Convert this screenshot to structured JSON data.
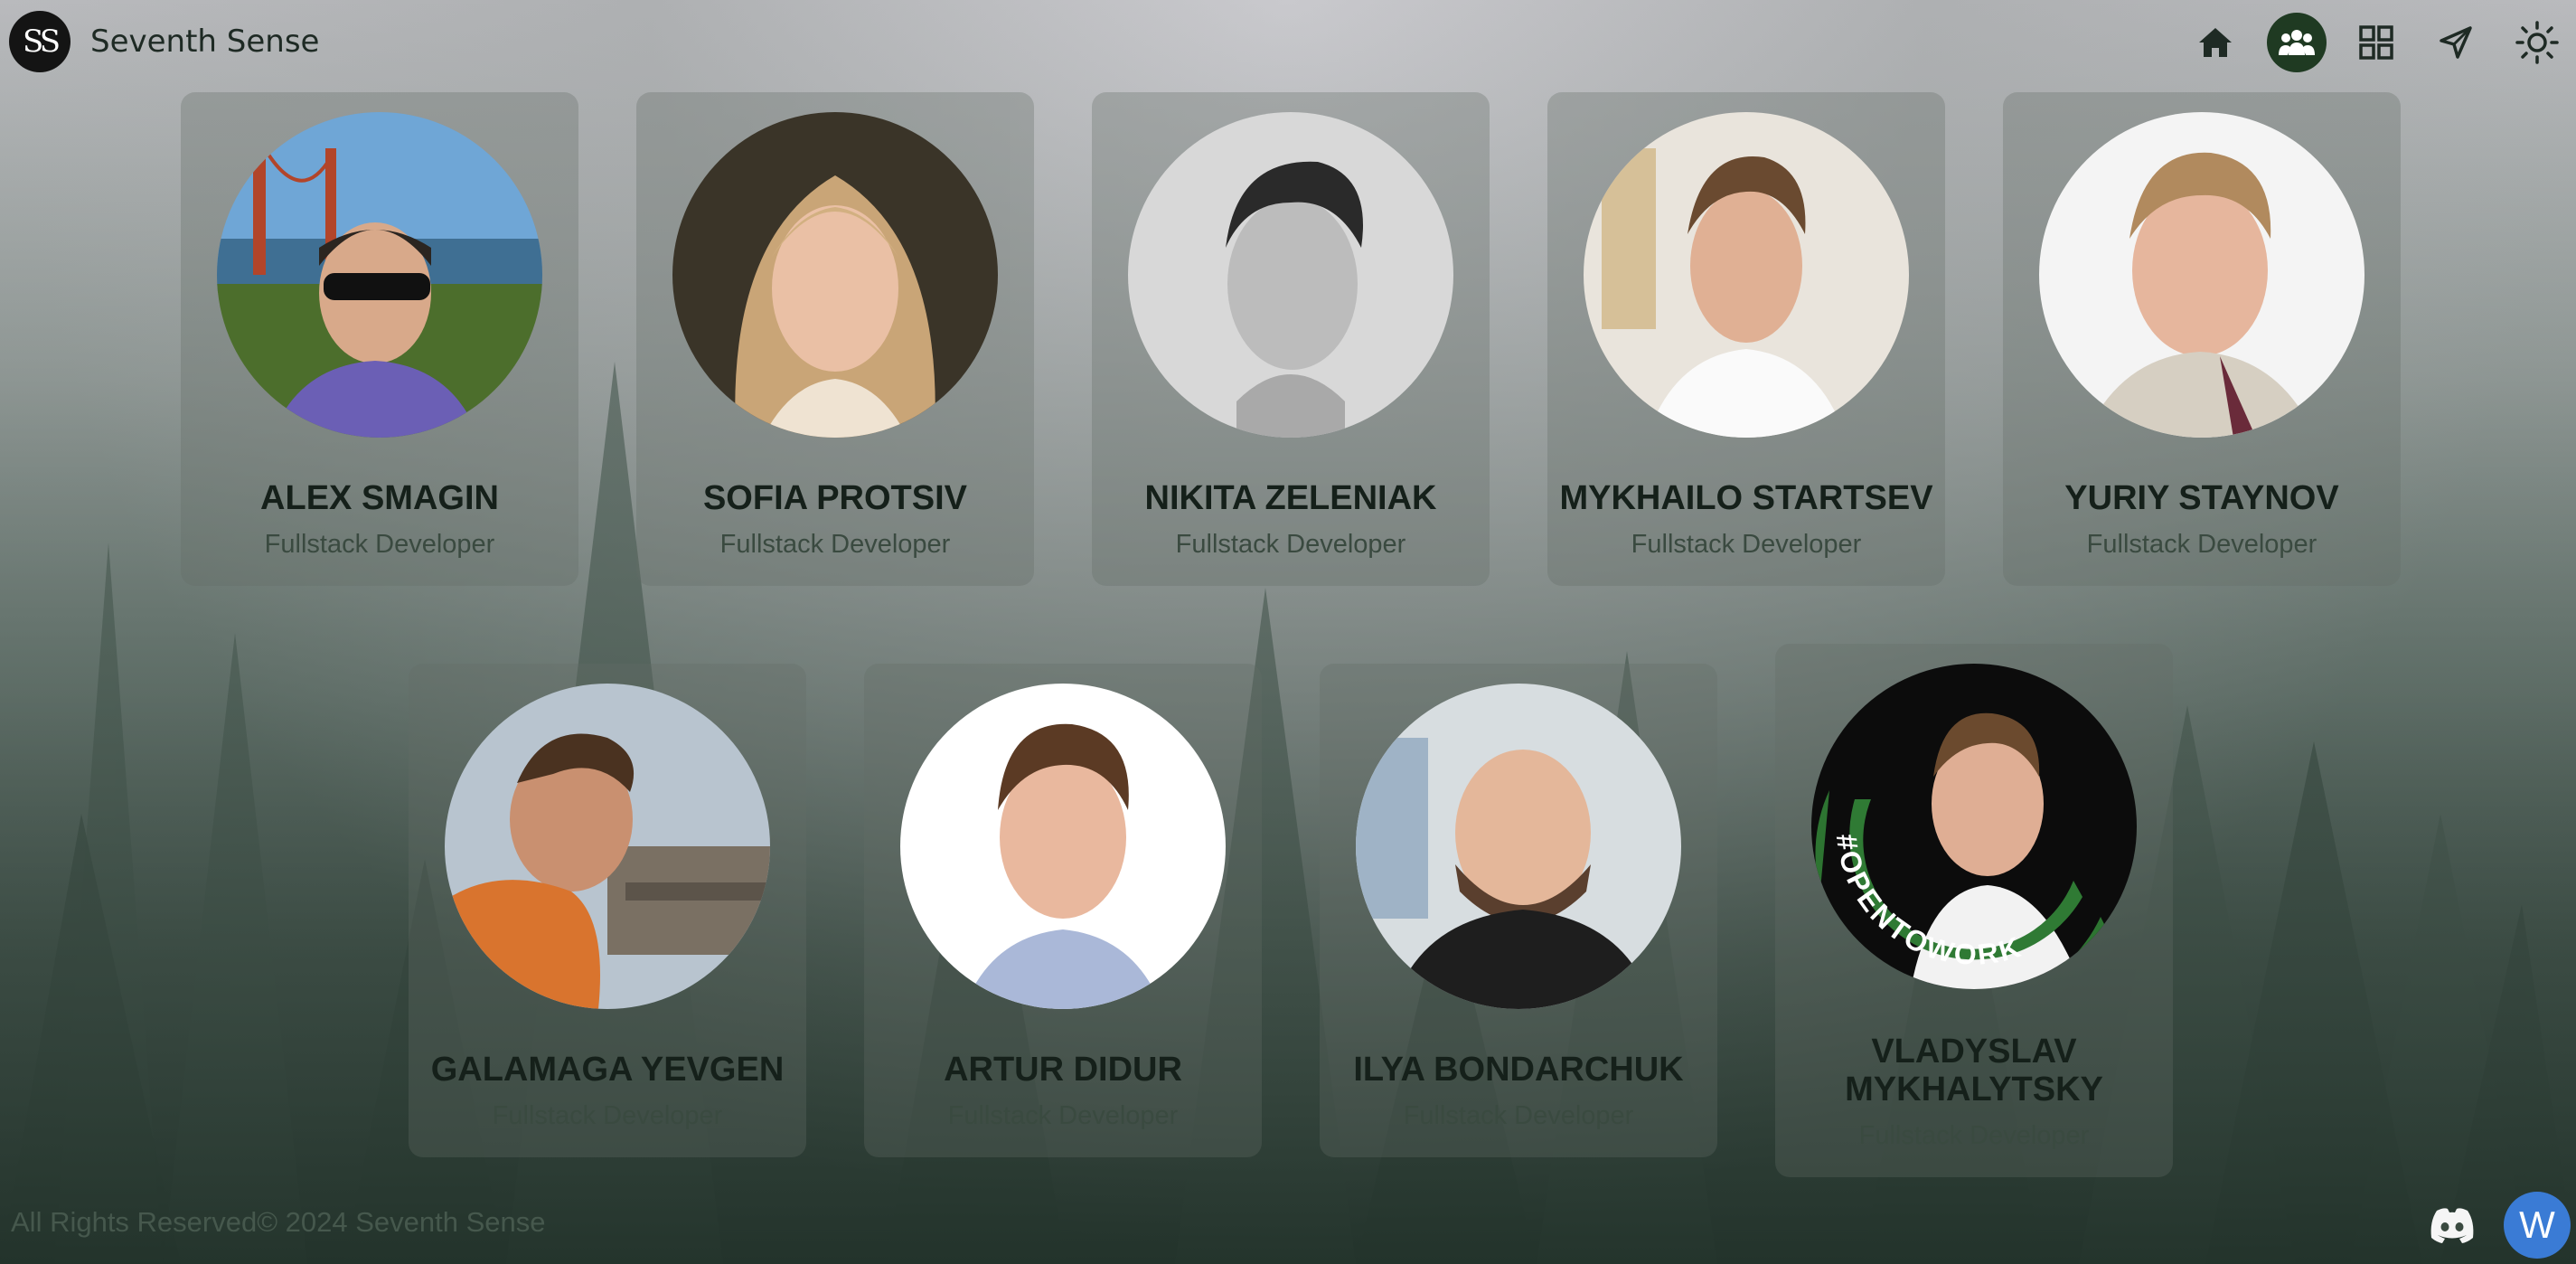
{
  "header": {
    "logo_text": "SS",
    "brand": "Seventh Sense",
    "nav": [
      {
        "icon": "home-icon"
      },
      {
        "icon": "team-icon",
        "active": true
      },
      {
        "icon": "grid-icon"
      },
      {
        "icon": "send-icon"
      },
      {
        "icon": "sun-icon"
      }
    ]
  },
  "team": [
    {
      "name": "ALEX SMAGIN",
      "role": "Fullstack Developer"
    },
    {
      "name": "SOFIA PROTSIV",
      "role": "Fullstack Developer"
    },
    {
      "name": "NIKITA ZELENIAK",
      "role": "Fullstack Developer"
    },
    {
      "name": "MYKHAILO STARTSEV",
      "role": "Fullstack Developer"
    },
    {
      "name": "YURIY STAYNOV",
      "role": "Fullstack Developer"
    },
    {
      "name": "GALAMAGA YEVGEN",
      "role": "Fullstack Developer"
    },
    {
      "name": "ARTUR DIDUR",
      "role": "Fullstack Developer"
    },
    {
      "name": "ILYA BONDARCHUK",
      "role": "Fullstack Developer"
    },
    {
      "name_line1": "VLADYSLAV",
      "name_line2": "MYKHALYTSKY",
      "role": "Fullstack Developer",
      "badge": "#OPENTOWORK"
    }
  ],
  "footer": {
    "copyright": "All Rights Reserved© 2024 Seventh Sense",
    "discord_icon": "discord-icon",
    "widget_label": "W"
  },
  "colors": {
    "accent": "#1f3a22",
    "opentowork": "#2f7a34",
    "widget": "#3a7bd5"
  }
}
